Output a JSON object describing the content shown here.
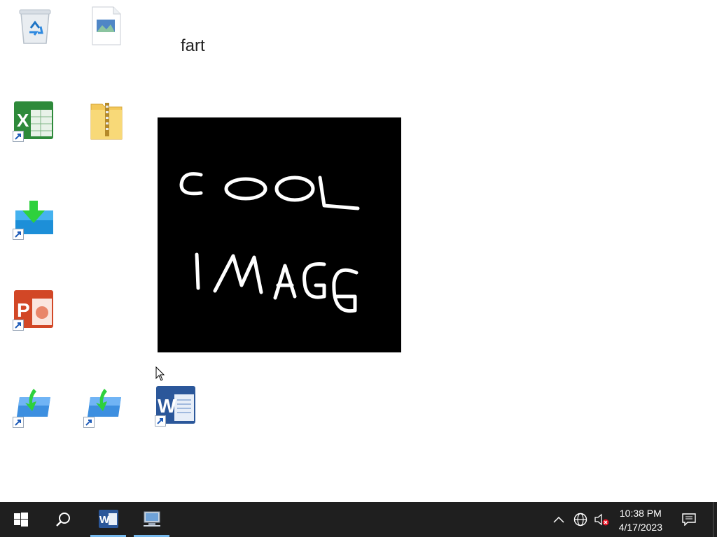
{
  "desktop": {
    "label_text": "fart",
    "drawing": {
      "line1": "COOL",
      "line2": "IMAGE"
    },
    "icons": [
      {
        "name": "recycle-bin-icon"
      },
      {
        "name": "image-file-icon"
      },
      {
        "name": "excel-shortcut-icon"
      },
      {
        "name": "zip-folder-icon"
      },
      {
        "name": "download-installer-shortcut-icon"
      },
      {
        "name": "powerpoint-shortcut-icon"
      },
      {
        "name": "remote-app-shortcut-icon"
      },
      {
        "name": "remote-app-shortcut-icon"
      },
      {
        "name": "word-shortcut-icon"
      }
    ]
  },
  "taskbar": {
    "clock": {
      "time": "10:38 PM",
      "date": "4/17/2023"
    },
    "pinned": [
      "start-button",
      "search-button",
      "word-taskbar-button",
      "network-app-taskbar-button"
    ],
    "tray": [
      "show-hidden-icons",
      "network-icon",
      "volume-muted-icon",
      "notification-center-icon"
    ]
  },
  "colors": {
    "taskbar_bg": "#1f1f1f",
    "active_indicator": "#76b9ed"
  }
}
